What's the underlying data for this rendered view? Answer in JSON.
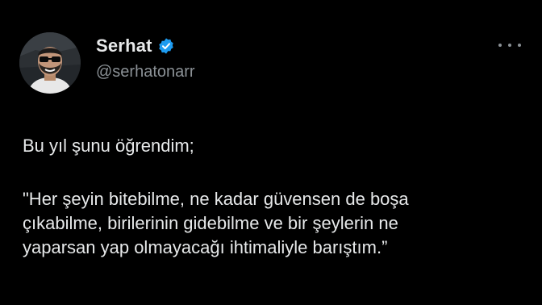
{
  "user": {
    "display_name": "Serhat",
    "handle": "@serhatonarr",
    "verified_icon": "verified-badge-icon",
    "verified_color": "#1d9bf0"
  },
  "menu": {
    "icon": "more-icon"
  },
  "post": {
    "paragraph1": "Bu yıl şunu öğrendim;",
    "paragraph2_lines": [
      "\"Her şeyin bitebilme, ne kadar güvensen de boşa",
      "çıkabilme, birilerinin gidebilme ve bir şeylerin ne",
      "yaparsan yap olmayacağı ihtimaliyle barıştım.”"
    ]
  },
  "colors": {
    "background": "#000000",
    "text": "#e7e9ea",
    "secondary": "#8b9196"
  }
}
